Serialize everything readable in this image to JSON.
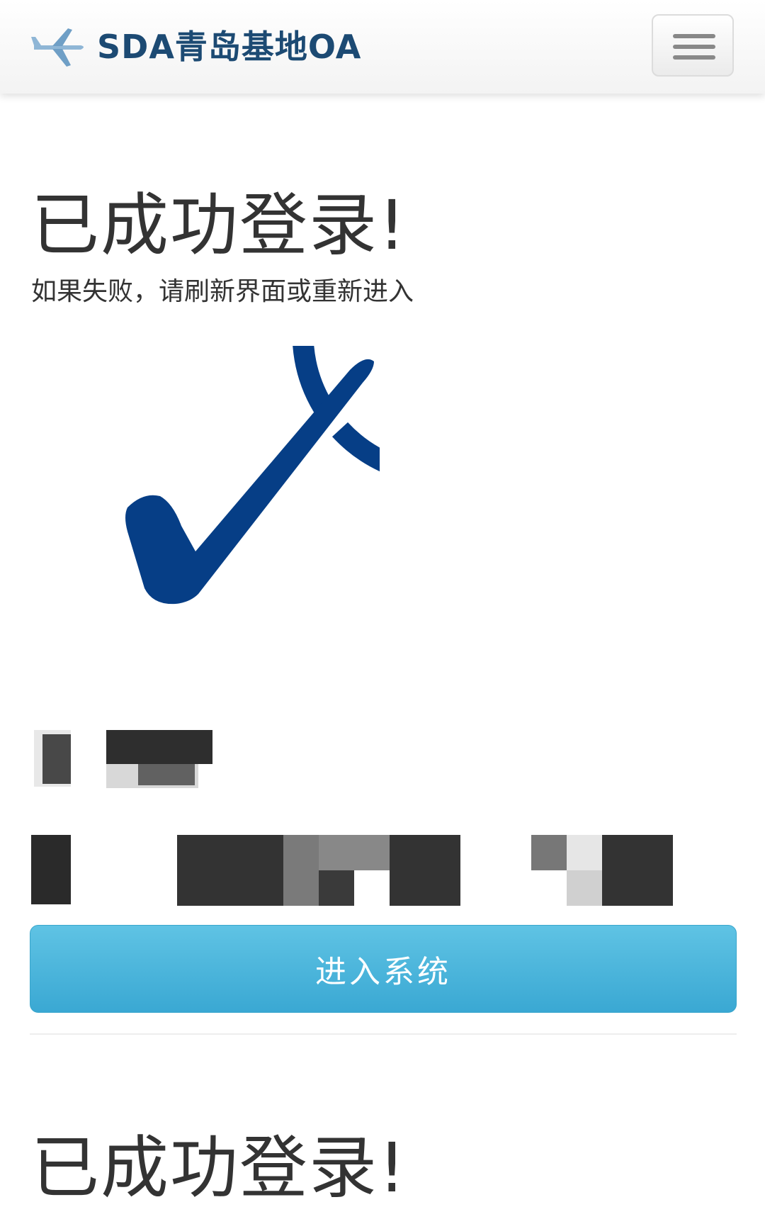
{
  "navbar": {
    "brand_title": "SDA青岛基地OA",
    "logo_icon": "airplane-icon",
    "menu_icon": "hamburger-menu-icon"
  },
  "main": {
    "heading": "已成功登录!",
    "subtext": "如果失败，请刷新界面或重新进入",
    "success_icon": "check-circle-icon",
    "enter_button_label": "进入系统",
    "second_heading": "已成功登录!"
  },
  "colors": {
    "brand": "#1c4a73",
    "check": "#063e86",
    "button": "#3aa8d3"
  }
}
